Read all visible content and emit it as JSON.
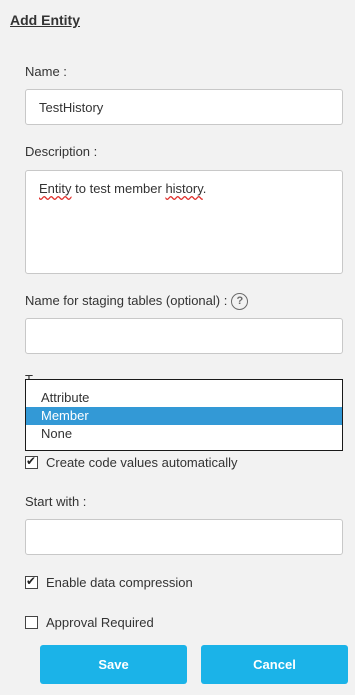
{
  "form": {
    "title": "Add Entity",
    "name": {
      "label": "Name :",
      "value": "TestHistory"
    },
    "description": {
      "label": "Description :",
      "value_part1": "Entity",
      "value_part2": " to test member ",
      "value_part3": "history",
      "value_part4": "."
    },
    "staging": {
      "label": "Name for staging tables (optional) :",
      "value": "",
      "help_glyph": "?"
    },
    "transaction_log_type": {
      "label_partial": "T",
      "options": [
        "Attribute",
        "Member",
        "None"
      ],
      "selected": "Member"
    },
    "create_code_values": {
      "label": "Create code values automatically",
      "checked": true
    },
    "start_with": {
      "label": "Start with :",
      "value": ""
    },
    "enable_compression": {
      "label": "Enable data compression",
      "checked": true
    },
    "approval_required": {
      "label": "Approval Required",
      "checked": false
    },
    "buttons": {
      "save": "Save",
      "cancel": "Cancel"
    }
  },
  "colors": {
    "background": "#f2f2f2",
    "button": "#1bb3e8",
    "selected_option": "#3399d6"
  }
}
